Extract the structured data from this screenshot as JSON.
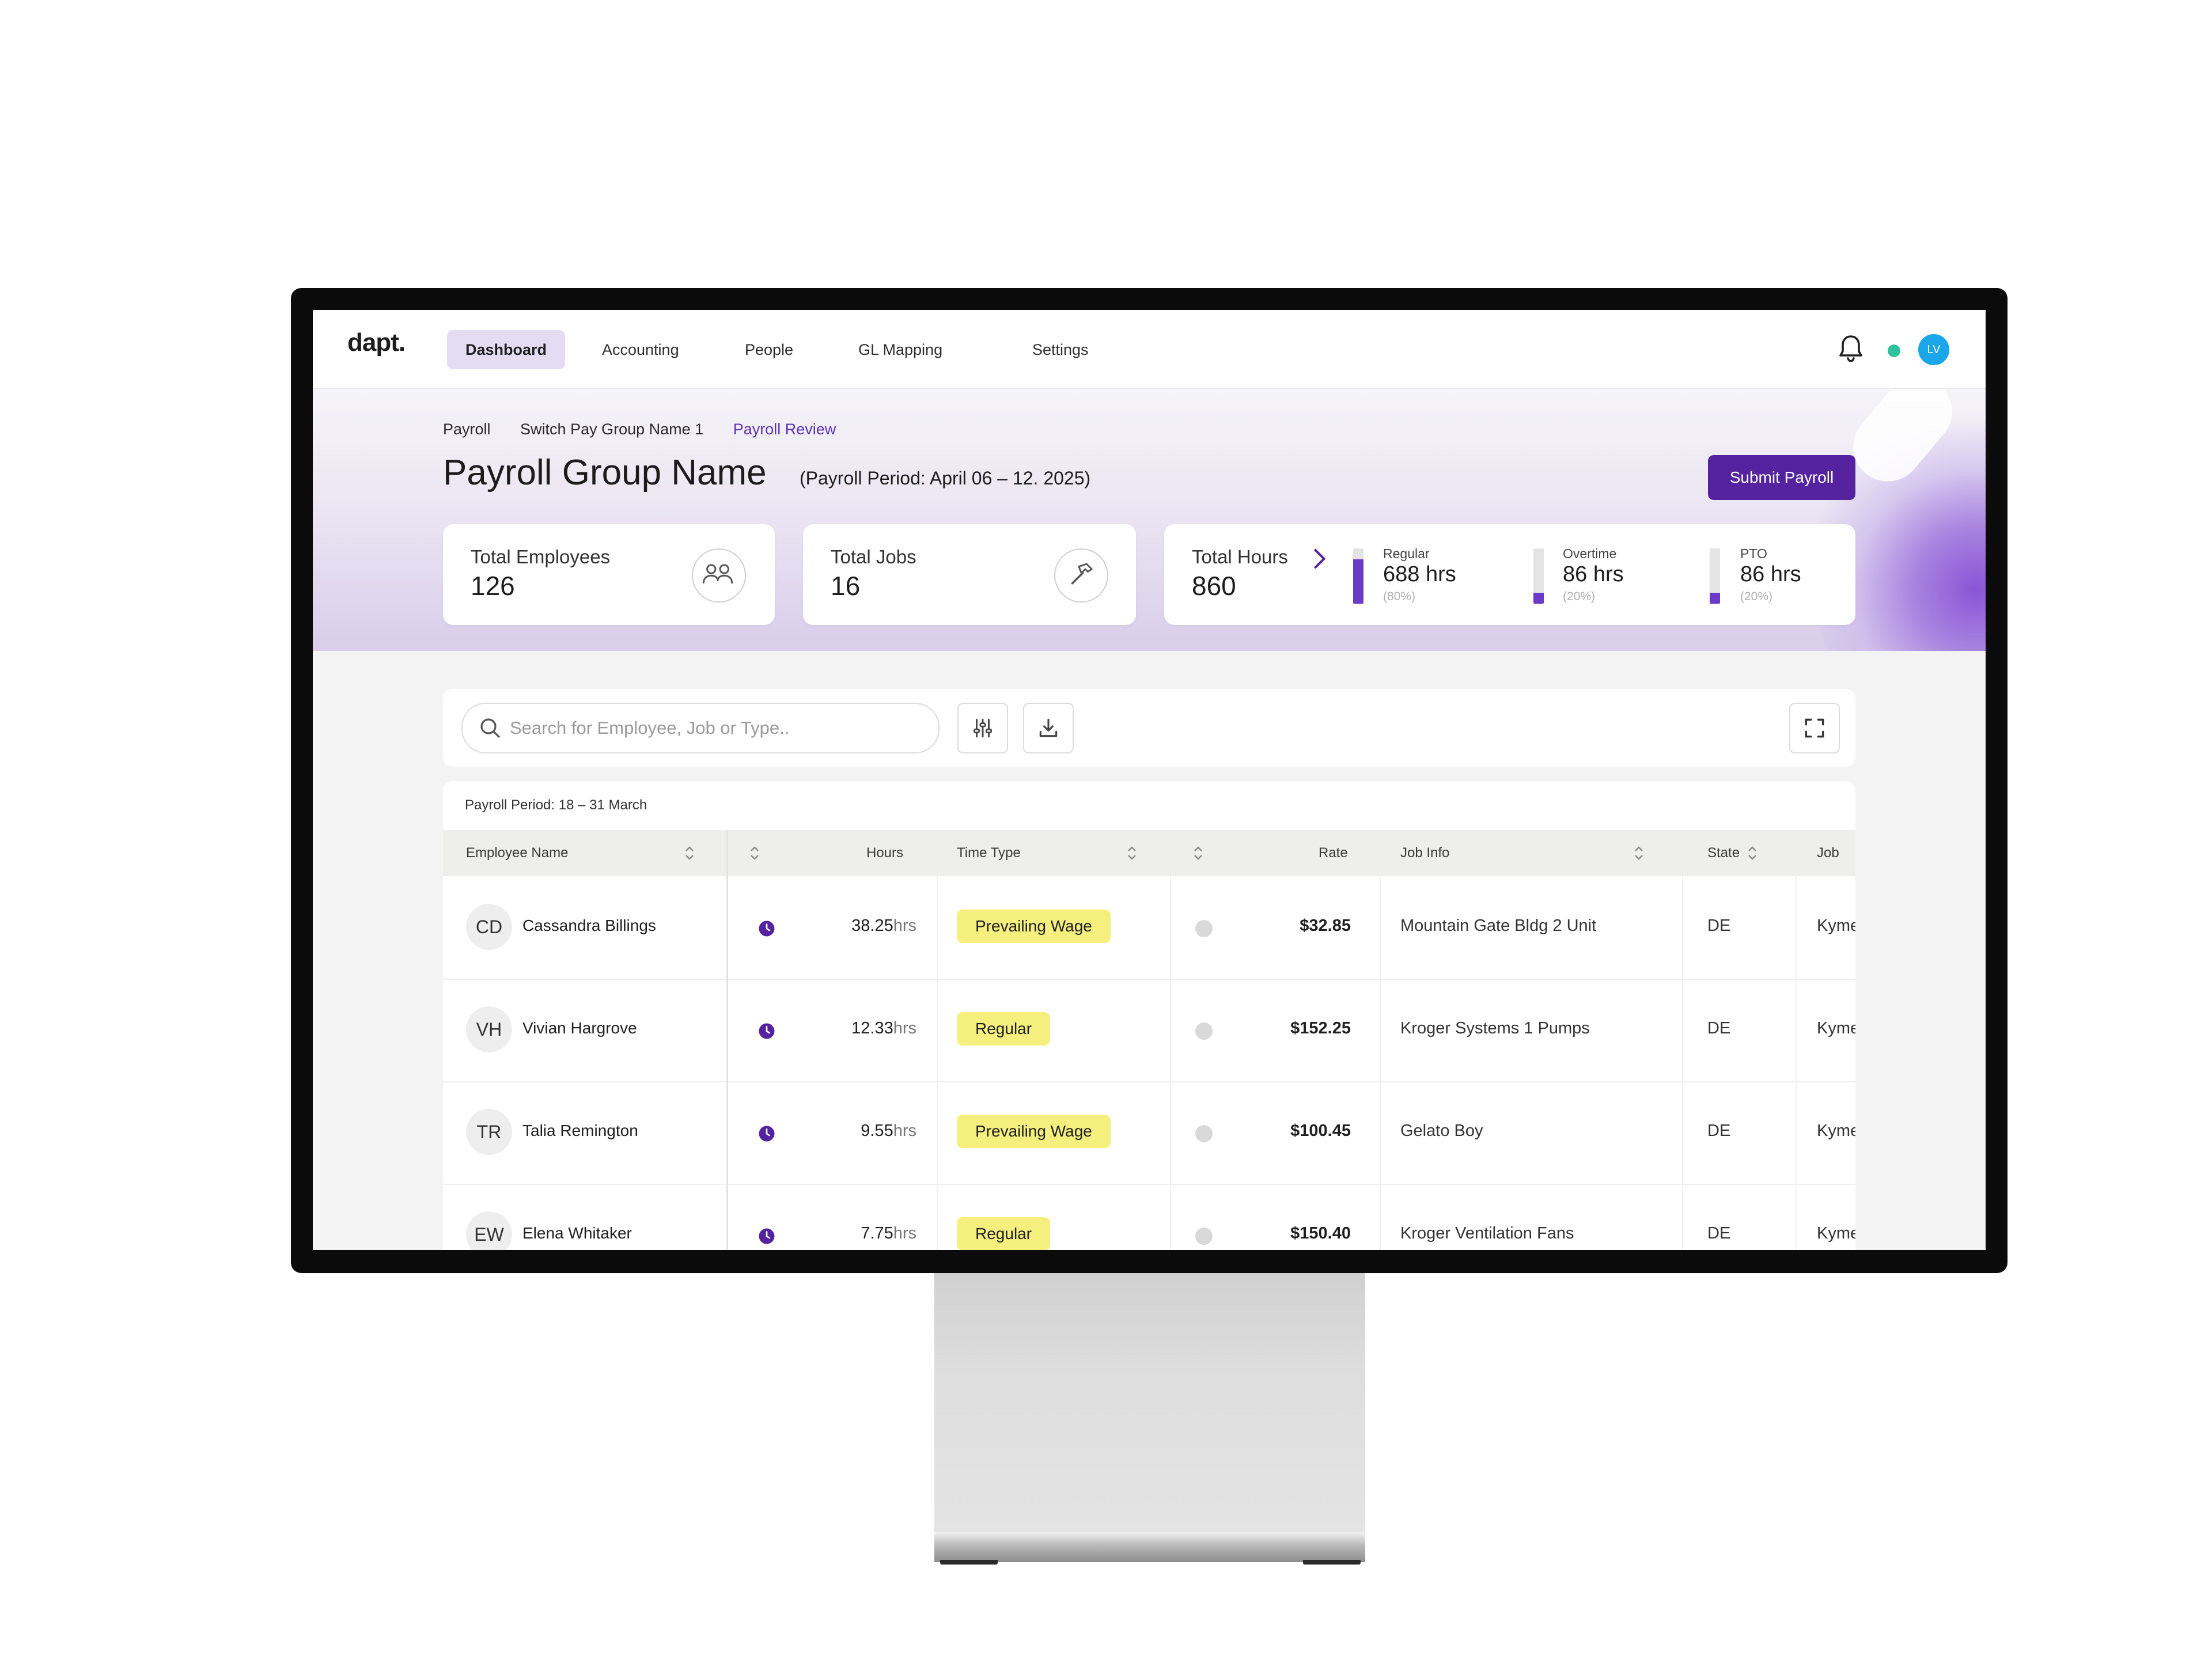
{
  "app": {
    "logo": "dapt."
  },
  "nav": {
    "tabs": [
      {
        "label": "Dashboard",
        "active": true
      },
      {
        "label": "Accounting",
        "active": false
      },
      {
        "label": "People",
        "active": false
      },
      {
        "label": "GL Mapping",
        "active": false
      },
      {
        "label": "Settings",
        "active": false
      }
    ],
    "user_initials": "LV",
    "icons": {
      "notifications": "bell-icon",
      "status": "online-dot"
    },
    "colors": {
      "status_online": "#2cc39a",
      "avatar": "#1aa6e8"
    }
  },
  "breadcrumb": [
    "Payroll",
    "Switch Pay Group Name 1",
    "Payroll Review"
  ],
  "header": {
    "title": "Payroll Group Name",
    "period": "(Payroll Period:  April 06 – 12. 2025)",
    "submit_label": "Submit Payroll",
    "accent_color": "#55239f"
  },
  "stats": {
    "employees": {
      "label": "Total Employees",
      "value": "126",
      "icon": "people-icon"
    },
    "jobs": {
      "label": "Total Jobs",
      "value": "16",
      "icon": "hammer-icon"
    },
    "hours": {
      "label": "Total Hours",
      "value": "860",
      "breakdown": [
        {
          "label": "Regular",
          "value": "688 hrs",
          "pct": "(80%)",
          "fill": 0.8
        },
        {
          "label": "Overtime",
          "value": "86 hrs",
          "pct": "(20%)",
          "fill": 0.2
        },
        {
          "label": "PTO",
          "value": "86 hrs",
          "pct": "(20%)",
          "fill": 0.2
        }
      ]
    }
  },
  "toolbar": {
    "search_placeholder": "Search for Employee, Job or Type..",
    "icons": [
      "search-icon",
      "filter-sliders-icon",
      "download-icon",
      "expand-icon"
    ]
  },
  "table": {
    "period": "Payroll Period: 18 – 31 March",
    "columns": {
      "employee": "Employee Name",
      "hours": "Hours",
      "time_type": "Time Type",
      "rate": "Rate",
      "job_info": "Job Info",
      "state": "State",
      "job": "Job"
    },
    "rows": [
      {
        "initials": "CD",
        "name": "Cassandra Billings",
        "hours": "38.25",
        "unit": "hrs",
        "time_type": "Prevailing Wage",
        "rate": "$32.85",
        "job_info": "Mountain Gate Bldg 2 Unit",
        "state": "DE",
        "job": "Kyme"
      },
      {
        "initials": "VH",
        "name": "Vivian Hargrove",
        "hours": "12.33",
        "unit": "hrs",
        "time_type": "Regular",
        "rate": "$152.25",
        "job_info": "Kroger Systems 1 Pumps",
        "state": "DE",
        "job": "Kyme"
      },
      {
        "initials": "TR",
        "name": "Talia Remington",
        "hours": "9.55",
        "unit": "hrs",
        "time_type": "Prevailing Wage",
        "rate": "$100.45",
        "job_info": "Gelato Boy",
        "state": "DE",
        "job": "Kyme"
      },
      {
        "initials": "EW",
        "name": "Elena Whitaker",
        "hours": "7.75",
        "unit": "hrs",
        "time_type": "Regular",
        "rate": "$150.40",
        "job_info": "Kroger Ventilation Fans",
        "state": "DE",
        "job": "Kyme"
      }
    ],
    "colors": {
      "badge": "#f5ef7e",
      "clock": "#55239f"
    }
  }
}
